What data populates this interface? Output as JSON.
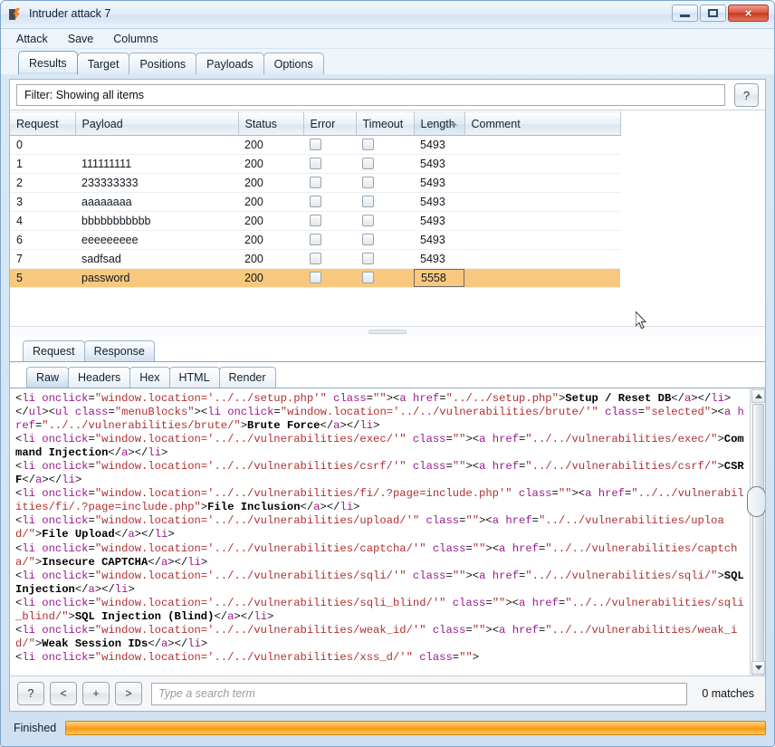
{
  "window": {
    "title": "Intruder attack 7",
    "icon": "burp-icon",
    "buttons": {
      "minimize": "minimize-button",
      "maximize": "maximize-button",
      "close": "×"
    }
  },
  "menu": {
    "items": [
      "Attack",
      "Save",
      "Columns"
    ]
  },
  "tabs": [
    {
      "label": "Results",
      "active": true
    },
    {
      "label": "Target",
      "active": false
    },
    {
      "label": "Positions",
      "active": false
    },
    {
      "label": "Payloads",
      "active": false
    },
    {
      "label": "Options",
      "active": false
    }
  ],
  "filter": {
    "text": "Filter: Showing all items",
    "help_label": "?"
  },
  "results_table": {
    "columns": [
      "Request",
      "Payload",
      "Status",
      "Error",
      "Timeout",
      "Length",
      "Comment"
    ],
    "sorted_column": "Length",
    "sort_direction": "ascending",
    "rows": [
      {
        "request": "0",
        "payload": "",
        "status": "200",
        "error": false,
        "timeout": false,
        "length": "5493",
        "comment": "",
        "highlighted": false,
        "length_selected": false
      },
      {
        "request": "1",
        "payload": "111111111",
        "status": "200",
        "error": false,
        "timeout": false,
        "length": "5493",
        "comment": "",
        "highlighted": false,
        "length_selected": false
      },
      {
        "request": "2",
        "payload": "233333333",
        "status": "200",
        "error": false,
        "timeout": false,
        "length": "5493",
        "comment": "",
        "highlighted": false,
        "length_selected": false
      },
      {
        "request": "3",
        "payload": "aaaaaaaa",
        "status": "200",
        "error": false,
        "timeout": false,
        "length": "5493",
        "comment": "",
        "highlighted": false,
        "length_selected": false
      },
      {
        "request": "4",
        "payload": "bbbbbbbbbbb",
        "status": "200",
        "error": false,
        "timeout": false,
        "length": "5493",
        "comment": "",
        "highlighted": false,
        "length_selected": false
      },
      {
        "request": "6",
        "payload": "eeeeeeeee",
        "status": "200",
        "error": false,
        "timeout": false,
        "length": "5493",
        "comment": "",
        "highlighted": false,
        "length_selected": false
      },
      {
        "request": "7",
        "payload": "sadfsad",
        "status": "200",
        "error": false,
        "timeout": false,
        "length": "5493",
        "comment": "",
        "highlighted": false,
        "length_selected": false
      },
      {
        "request": "5",
        "payload": "password",
        "status": "200",
        "error": false,
        "timeout": false,
        "length": "5558",
        "comment": "",
        "highlighted": true,
        "length_selected": true
      }
    ]
  },
  "message_tabs": [
    {
      "label": "Request",
      "active": false
    },
    {
      "label": "Response",
      "active": true
    }
  ],
  "view_tabs": [
    {
      "label": "Raw",
      "active": true
    },
    {
      "label": "Headers",
      "active": false
    },
    {
      "label": "Hex",
      "active": false
    },
    {
      "label": "HTML",
      "active": false
    },
    {
      "label": "Render",
      "active": false
    }
  ],
  "response_body": "<li onclick=\"window.location='../../setup.php'\" class=\"\"><a href=\"../../setup.php\">Setup / Reset DB</a></li>\n</ul><ul class=\"menuBlocks\"><li onclick=\"window.location='../../vulnerabilities/brute/'\" class=\"selected\"><a href=\"../../vulnerabilities/brute/\">Brute Force</a></li>\n<li onclick=\"window.location='../../vulnerabilities/exec/'\" class=\"\"><a href=\"../../vulnerabilities/exec/\">Command Injection</a></li>\n<li onclick=\"window.location='../../vulnerabilities/csrf/'\" class=\"\"><a href=\"../../vulnerabilities/csrf/\">CSRF</a></li>\n<li onclick=\"window.location='../../vulnerabilities/fi/.?page=include.php'\" class=\"\"><a href=\"../../vulnerabilities/fi/.?page=include.php\">File Inclusion</a></li>\n<li onclick=\"window.location='../../vulnerabilities/upload/'\" class=\"\"><a href=\"../../vulnerabilities/upload/\">File Upload</a></li>\n<li onclick=\"window.location='../../vulnerabilities/captcha/'\" class=\"\"><a href=\"../../vulnerabilities/captcha/\">Insecure CAPTCHA</a></li>\n<li onclick=\"window.location='../../vulnerabilities/sqli/'\" class=\"\"><a href=\"../../vulnerabilities/sqli/\">SQL Injection</a></li>\n<li onclick=\"window.location='../../vulnerabilities/sqli_blind/'\" class=\"\"><a href=\"../../vulnerabilities/sqli_blind/\">SQL Injection (Blind)</a></li>\n<li onclick=\"window.location='../../vulnerabilities/weak_id/'\" class=\"\"><a href=\"../../vulnerabilities/weak_id/\">Weak Session IDs</a></li>\n<li onclick=\"window.location='../../vulnerabilities/xss_d/'\" class=\"\">",
  "search_toolbar": {
    "help": "?",
    "prev": "<",
    "add": "+",
    "next": ">",
    "placeholder": "Type a search term",
    "value": "",
    "matches": "0 matches"
  },
  "status": {
    "text": "Finished",
    "progress_percent": 100
  },
  "colors": {
    "highlight_row": "#f9c87f",
    "progress": "#f59a16",
    "close_button": "#c53a22",
    "tag": "#2222cc",
    "attr": "#9b1a8e",
    "value": "#b03030"
  }
}
